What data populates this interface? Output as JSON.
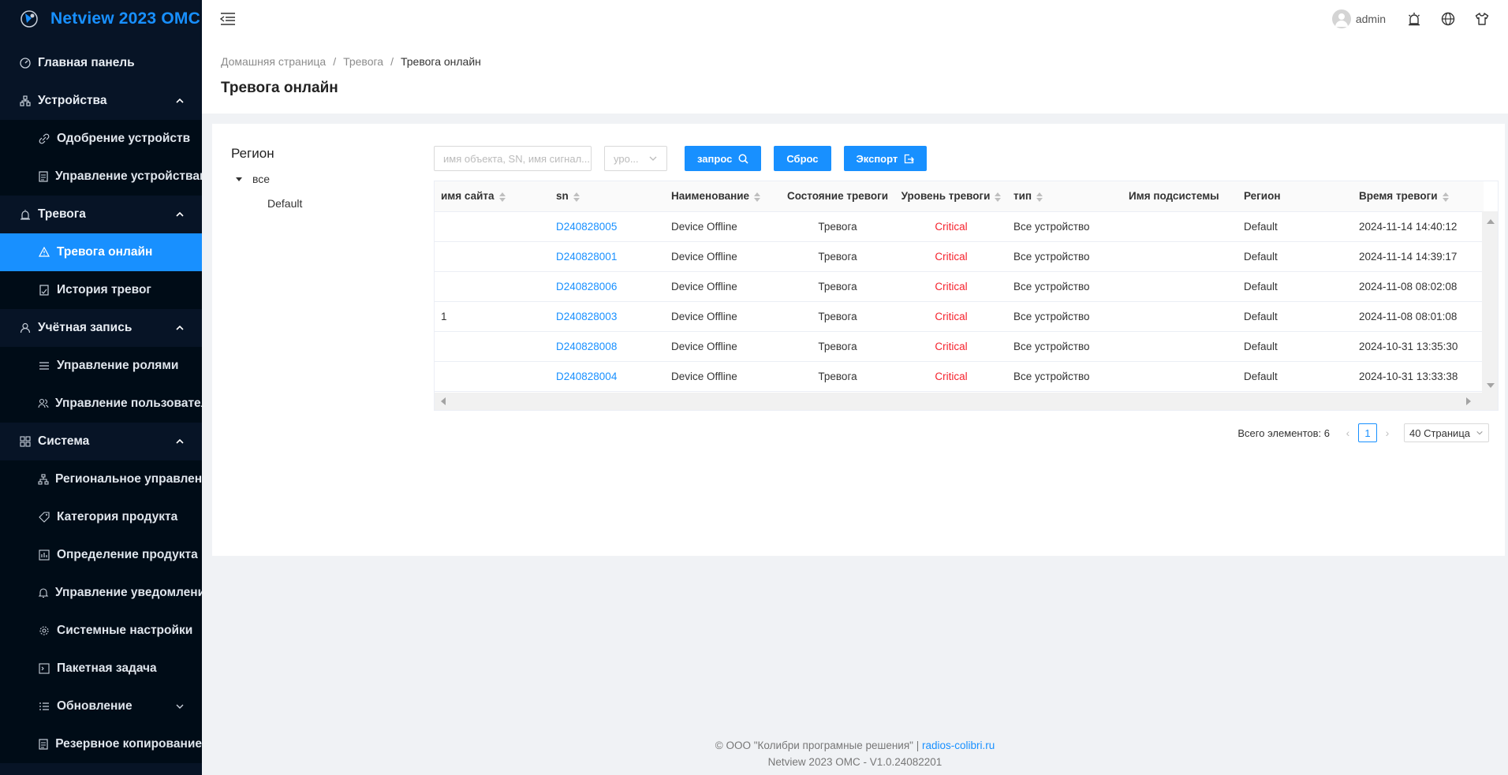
{
  "app": {
    "title": "Netview 2023 OMC"
  },
  "sidebar": {
    "main_panel": "Главная панель",
    "devices": "Устройства",
    "device_approval": "Одобрение устройств",
    "device_management": "Управление устройствами",
    "alarm": "Тревога",
    "alarm_online": "Тревога онлайн",
    "alarm_history": "История тревог",
    "account": "Учётная запись",
    "role_management": "Управление ролями",
    "user_management": "Управление пользователями",
    "system": "Система",
    "regional_management": "Региональное управление",
    "product_category": "Категория продукта",
    "product_definition": "Определение продукта",
    "notification_management": "Управление уведомлениями",
    "system_settings": "Системные настройки",
    "batch_task": "Пакетная задача",
    "update": "Обновление",
    "backup": "Резервное копирование"
  },
  "header": {
    "username": "admin"
  },
  "breadcrumb": {
    "home": "Домашняя страница",
    "alarm": "Тревога",
    "current": "Тревога онлайн"
  },
  "page": {
    "title": "Тревога онлайн"
  },
  "region": {
    "title": "Регион",
    "root": "все",
    "child": "Default"
  },
  "toolbar": {
    "search_placeholder": "имя объекта, SN, имя сигнал...",
    "level_placeholder": "уро...",
    "query_label": "запрос",
    "reset_label": "Сброс",
    "export_label": "Экспорт"
  },
  "table": {
    "columns": [
      "имя сайта",
      "sn",
      "Наименование",
      "Состояние тревоги",
      "Уровень тревоги",
      "тип",
      "Имя подсистемы",
      "Регион",
      "Время тревоги"
    ],
    "rows": [
      {
        "site": "",
        "sn": "D240828005",
        "name": "Device Offline",
        "state": "Тревога",
        "level": "Critical",
        "type": "Все устройство",
        "subsystem": "",
        "region": "Default",
        "time": "2024-11-14 14:40:12"
      },
      {
        "site": "",
        "sn": "D240828001",
        "name": "Device Offline",
        "state": "Тревога",
        "level": "Critical",
        "type": "Все устройство",
        "subsystem": "",
        "region": "Default",
        "time": "2024-11-14 14:39:17"
      },
      {
        "site": "",
        "sn": "D240828006",
        "name": "Device Offline",
        "state": "Тревога",
        "level": "Critical",
        "type": "Все устройство",
        "subsystem": "",
        "region": "Default",
        "time": "2024-11-08 08:02:08"
      },
      {
        "site": "1",
        "sn": "D240828003",
        "name": "Device Offline",
        "state": "Тревога",
        "level": "Critical",
        "type": "Все устройство",
        "subsystem": "",
        "region": "Default",
        "time": "2024-11-08 08:01:08"
      },
      {
        "site": "",
        "sn": "D240828008",
        "name": "Device Offline",
        "state": "Тревога",
        "level": "Critical",
        "type": "Все устройство",
        "subsystem": "",
        "region": "Default",
        "time": "2024-10-31 13:35:30"
      },
      {
        "site": "",
        "sn": "D240828004",
        "name": "Device Offline",
        "state": "Тревога",
        "level": "Critical",
        "type": "Все устройство",
        "subsystem": "",
        "region": "Default",
        "time": "2024-10-31 13:33:38"
      }
    ]
  },
  "pagination": {
    "total_label": "Всего элементов: 6",
    "current_page": "1",
    "page_size": "40 Страница"
  },
  "footer": {
    "copyright": "© ООО \"Колибри програмные решения\" | ",
    "link": "radios-colibri.ru",
    "version": "Netview 2023 OMC - V1.0.24082201"
  },
  "colors": {
    "accent": "#1890ff",
    "sidebar_bg": "#071426",
    "critical": "#f5222d"
  }
}
